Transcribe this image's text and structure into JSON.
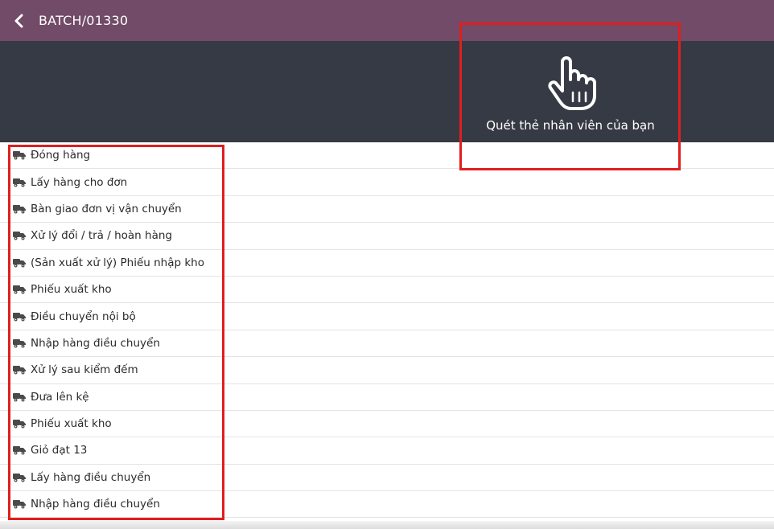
{
  "header": {
    "title": "BATCH/01330"
  },
  "scan": {
    "label": "Quét thẻ nhân viên của bạn"
  },
  "colors": {
    "header_bg": "#714b67",
    "panel_bg": "#363a44",
    "highlight": "#e01e1e"
  },
  "operations": [
    {
      "label": "Đóng hàng",
      "icon": "truck-icon"
    },
    {
      "label": "Lấy hàng cho đơn",
      "icon": "truck-icon"
    },
    {
      "label": "Bàn giao đơn vị vận chuyển",
      "icon": "truck-icon"
    },
    {
      "label": "Xử lý đổi / trả / hoàn hàng",
      "icon": "truck-icon"
    },
    {
      "label": "(Sản xuất xử lý) Phiếu nhập kho",
      "icon": "truck-icon"
    },
    {
      "label": "Phiếu xuất kho",
      "icon": "truck-icon"
    },
    {
      "label": "Điều chuyển nội bộ",
      "icon": "truck-icon"
    },
    {
      "label": "Nhập hàng điều chuyển",
      "icon": "truck-icon"
    },
    {
      "label": "Xử lý sau kiểm đếm",
      "icon": "truck-icon"
    },
    {
      "label": "Đưa lên kệ",
      "icon": "truck-icon"
    },
    {
      "label": "Phiếu xuất kho",
      "icon": "truck-icon"
    },
    {
      "label": "Giỏ đạt 13",
      "icon": "truck-icon"
    },
    {
      "label": "Lấy hàng điều chuyển",
      "icon": "truck-icon"
    },
    {
      "label": "Nhập hàng điều chuyển",
      "icon": "truck-icon"
    }
  ]
}
